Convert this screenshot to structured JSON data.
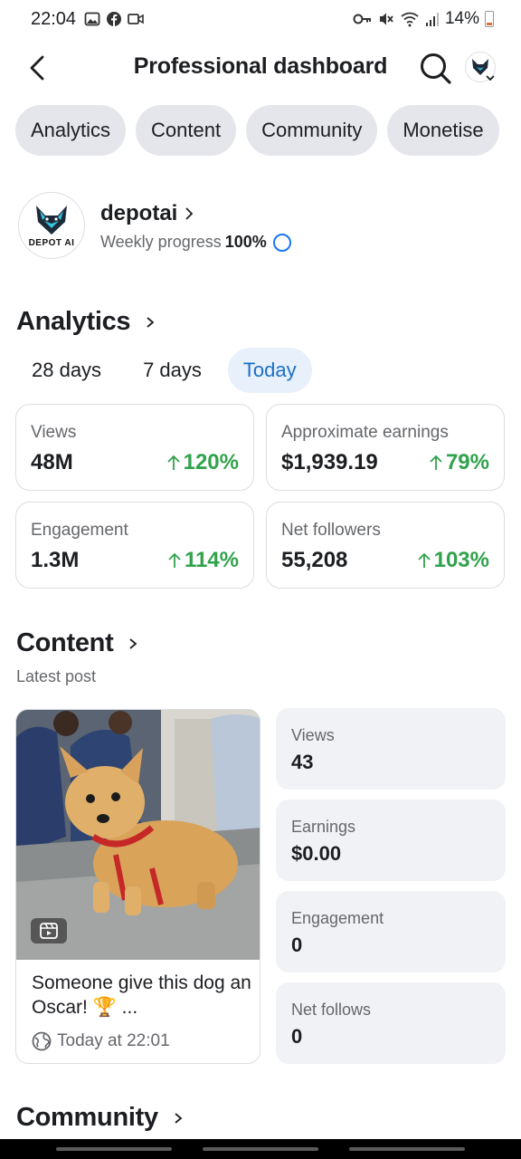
{
  "status_bar": {
    "time": "22:04",
    "battery": "14%"
  },
  "header": {
    "title": "Professional dashboard"
  },
  "tabs": [
    {
      "label": "Analytics"
    },
    {
      "label": "Content"
    },
    {
      "label": "Community"
    },
    {
      "label": "Monetise"
    }
  ],
  "profile": {
    "name": "depotai",
    "logo_text": "DEPOT AI",
    "progress_label": "Weekly progress",
    "progress_value": "100%"
  },
  "analytics": {
    "title": "Analytics",
    "ranges": [
      {
        "label": "28 days",
        "active": false
      },
      {
        "label": "7 days",
        "active": false
      },
      {
        "label": "Today",
        "active": true
      }
    ],
    "metrics": [
      {
        "label": "Views",
        "value": "48M",
        "change": "120%"
      },
      {
        "label": "Approximate earnings",
        "value": "$1,939.19",
        "change": "79%"
      },
      {
        "label": "Engagement",
        "value": "1.3M",
        "change": "114%"
      },
      {
        "label": "Net followers",
        "value": "55,208",
        "change": "103%"
      }
    ]
  },
  "content": {
    "title": "Content",
    "subtitle": "Latest post",
    "post": {
      "caption": "Someone give this dog an Oscar! 🏆 ...",
      "time": "Today at 22:01"
    },
    "stats": [
      {
        "label": "Views",
        "value": "43"
      },
      {
        "label": "Earnings",
        "value": "$0.00"
      },
      {
        "label": "Engagement",
        "value": "0"
      },
      {
        "label": "Net follows",
        "value": "0"
      }
    ]
  },
  "community": {
    "title": "Community"
  },
  "colors": {
    "accent": "#1877f2",
    "positive": "#31a24c",
    "active_range_bg": "#e7f0fb"
  }
}
